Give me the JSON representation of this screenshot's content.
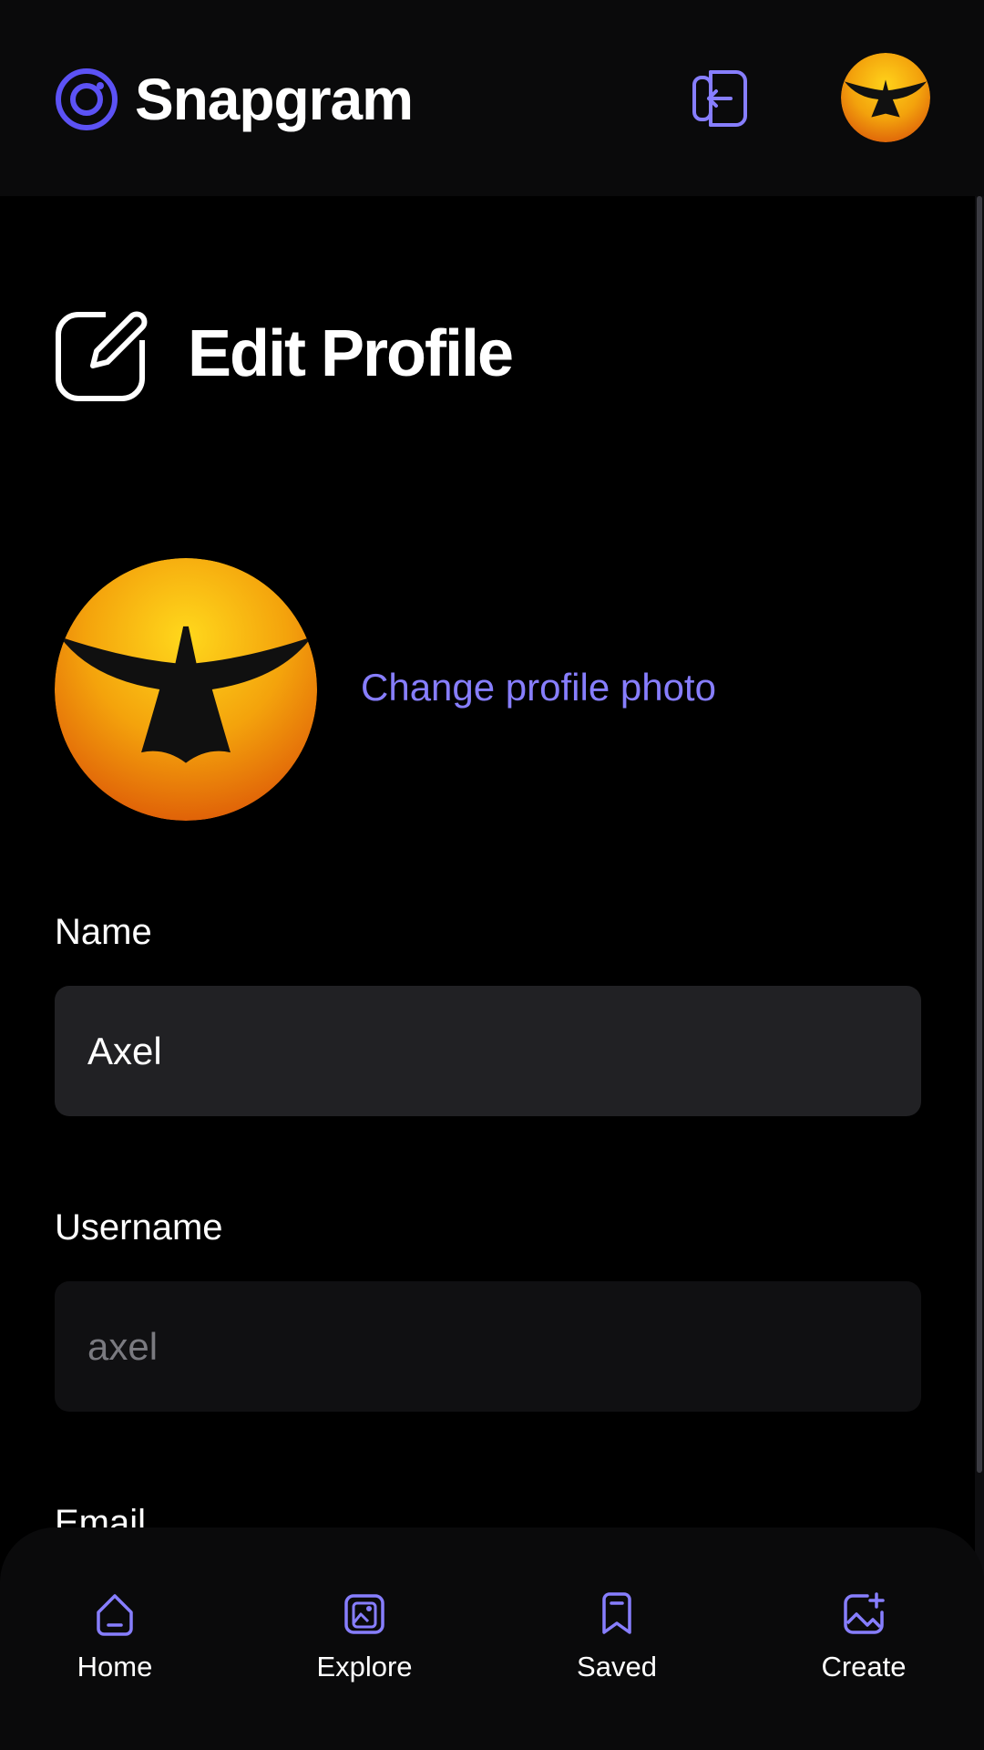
{
  "app": {
    "name": "Snapgram"
  },
  "colors": {
    "accent": "#877eff",
    "logo": "#5c52f5",
    "background": "#000000",
    "input_name_bg": "#212124",
    "input_username_bg": "#101012"
  },
  "header": {
    "logout_icon": "logout-icon",
    "avatar_icon": "bird-silhouette-avatar"
  },
  "page": {
    "title": "Edit Profile",
    "title_icon": "edit-square-icon"
  },
  "profile": {
    "change_photo_label": "Change profile photo"
  },
  "form": {
    "name_label": "Name",
    "name_value": "Axel",
    "username_label": "Username",
    "username_value": "axel",
    "email_label": "Email"
  },
  "bottom_nav": {
    "items": [
      {
        "label": "Home",
        "icon": "home-icon"
      },
      {
        "label": "Explore",
        "icon": "explore-icon"
      },
      {
        "label": "Saved",
        "icon": "bookmark-icon"
      },
      {
        "label": "Create",
        "icon": "create-image-icon"
      }
    ]
  }
}
